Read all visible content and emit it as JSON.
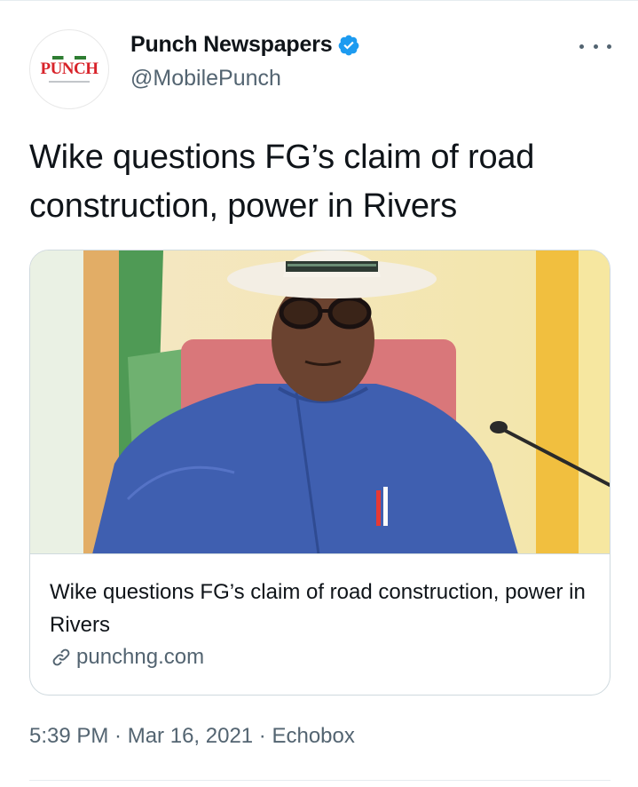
{
  "account": {
    "display_name": "Punch Newspapers",
    "handle": "@MobilePunch",
    "verified": true,
    "avatar_logo_text": "PUNCH"
  },
  "tweet": {
    "text": "Wike questions FG’s claim of road construction, power in Rivers"
  },
  "card": {
    "title": "Wike questions FG’s claim of road construction, power in Rivers",
    "domain": "punchng.com",
    "image_icon": "photo-of-man-in-white-hat"
  },
  "meta": {
    "time": "5:39 PM",
    "separator": " · ",
    "date": "Mar 16, 2021",
    "source": "Echobox"
  },
  "colors": {
    "verified_blue": "#1d9bf0",
    "secondary_text": "#536471",
    "border": "#cfd9de",
    "brand_red": "#d8232a"
  }
}
